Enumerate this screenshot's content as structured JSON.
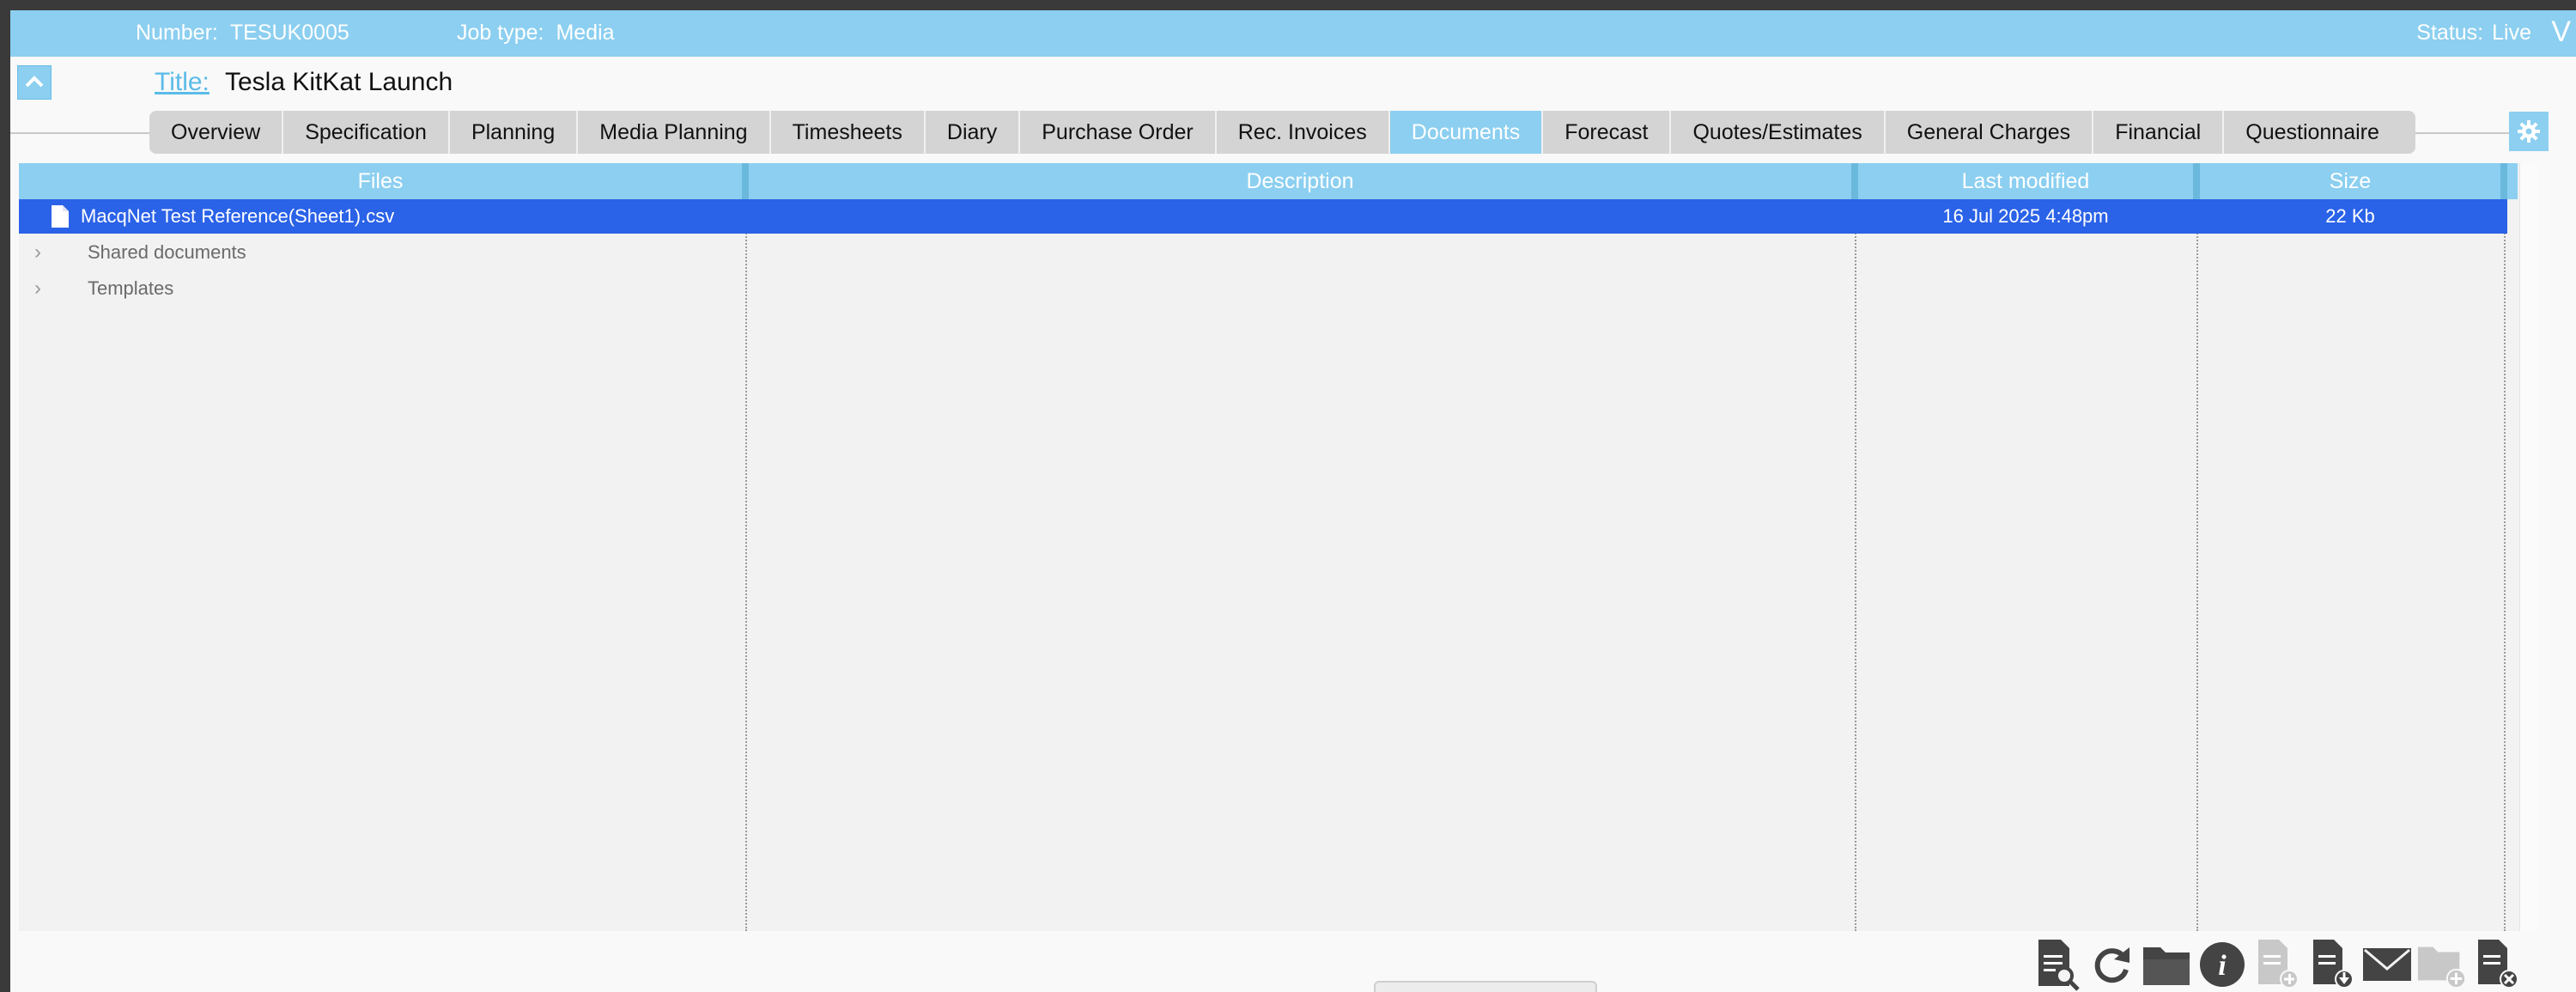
{
  "header": {
    "number_label": "Number:",
    "number_value": "TESUK0005",
    "job_type_label": "Job type:",
    "job_type_value": "Media",
    "status_label": "Status:",
    "status_value": "Live",
    "menu_glyph": "V"
  },
  "title": {
    "label": "Title:",
    "value": "Tesla KitKat Launch"
  },
  "tabs": [
    {
      "label": "Overview"
    },
    {
      "label": "Specification"
    },
    {
      "label": "Planning"
    },
    {
      "label": "Media Planning"
    },
    {
      "label": "Timesheets"
    },
    {
      "label": "Diary"
    },
    {
      "label": "Purchase Order"
    },
    {
      "label": "Rec. Invoices"
    },
    {
      "label": "Documents",
      "active": true
    },
    {
      "label": "Forecast"
    },
    {
      "label": "Quotes/Estimates"
    },
    {
      "label": "General Charges"
    },
    {
      "label": "Financial"
    },
    {
      "label": "Questionnaire"
    }
  ],
  "table": {
    "columns": [
      "Files",
      "Description",
      "Last modified",
      "Size"
    ],
    "selected_file": {
      "name": "MacqNet Test Reference(Sheet1).csv",
      "description": "",
      "modified": "16 Jul 2025 4:48pm",
      "size": "22 Kb"
    },
    "folders": [
      "Shared documents",
      "Templates"
    ]
  },
  "toolbar": {
    "icons": [
      "preview-document-icon",
      "refresh-icon",
      "open-folder-icon",
      "info-icon",
      "add-document-icon",
      "download-document-icon",
      "email-icon",
      "add-folder-icon",
      "delete-document-icon"
    ]
  },
  "colors": {
    "accent": "#8ccff0",
    "selection": "#2a62e8",
    "table_bg": "#f2f2f2"
  }
}
